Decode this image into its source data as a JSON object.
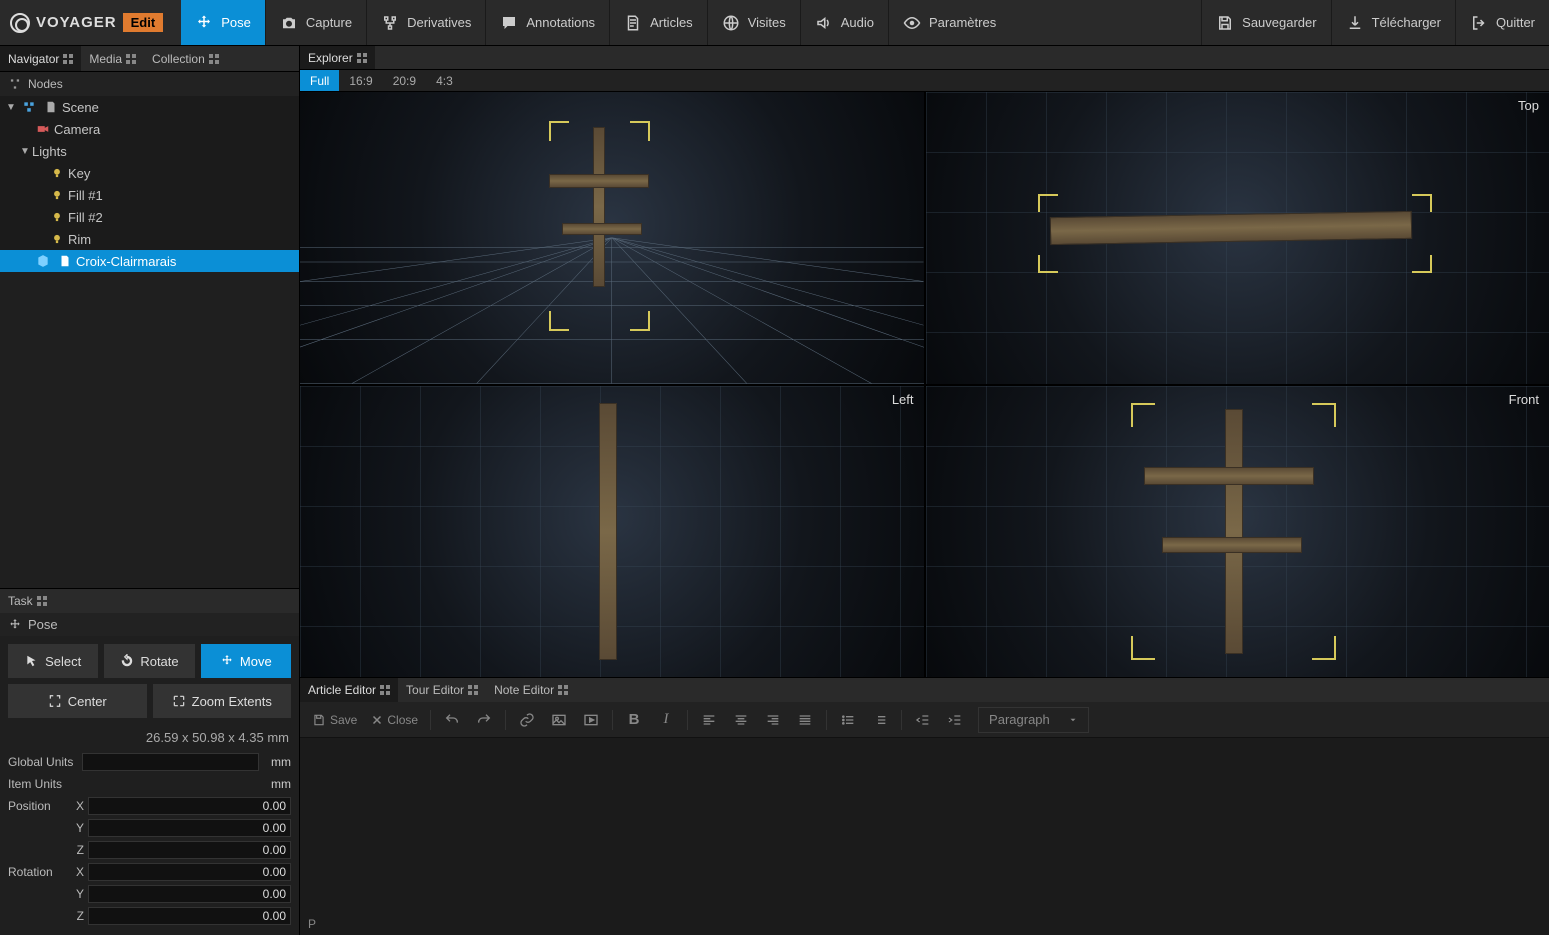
{
  "brand": {
    "title": "VOYAGER",
    "badge": "Edit"
  },
  "menu": {
    "left": [
      {
        "id": "pose",
        "label": "Pose",
        "active": true
      },
      {
        "id": "capture",
        "label": "Capture"
      },
      {
        "id": "derivatives",
        "label": "Derivatives"
      },
      {
        "id": "annotations",
        "label": "Annotations"
      },
      {
        "id": "articles",
        "label": "Articles"
      },
      {
        "id": "visites",
        "label": "Visites"
      },
      {
        "id": "audio",
        "label": "Audio"
      },
      {
        "id": "parametres",
        "label": "Paramètres"
      }
    ],
    "right": [
      {
        "id": "save",
        "label": "Sauvegarder"
      },
      {
        "id": "download",
        "label": "Télécharger"
      },
      {
        "id": "exit",
        "label": "Quitter"
      }
    ]
  },
  "leftPanel": {
    "tabs": [
      "Navigator",
      "Media",
      "Collection"
    ],
    "nodesHeader": "Nodes",
    "tree": {
      "scene": "Scene",
      "camera": "Camera",
      "lights": "Lights",
      "key": "Key",
      "fill1": "Fill #1",
      "fill2": "Fill #2",
      "rim": "Rim",
      "model": "Croix-Clairmarais"
    }
  },
  "task": {
    "header": "Task",
    "subhead": "Pose",
    "buttons": {
      "select": "Select",
      "rotate": "Rotate",
      "move": "Move",
      "center": "Center",
      "zoom": "Zoom Extents"
    },
    "dimensions": "26.59 x 50.98 x 4.35 mm",
    "globalUnits": {
      "label": "Global Units",
      "value": "mm"
    },
    "itemUnits": {
      "label": "Item Units",
      "value": "mm"
    },
    "position": {
      "label": "Position",
      "x": "0.00",
      "y": "0.00",
      "z": "0.00"
    },
    "rotation": {
      "label": "Rotation",
      "x": "0.00",
      "y": "0.00",
      "z": "0.00"
    },
    "axes": {
      "x": "X",
      "y": "Y",
      "z": "Z"
    }
  },
  "explorer": {
    "tab": "Explorer",
    "aspects": [
      "Full",
      "16:9",
      "20:9",
      "4:3"
    ],
    "views": {
      "top": "Top",
      "left": "Left",
      "front": "Front"
    }
  },
  "editor": {
    "tabs": [
      "Article Editor",
      "Tour Editor",
      "Note Editor"
    ],
    "save": "Save",
    "close": "Close",
    "paragraph": "Paragraph",
    "status": "P"
  }
}
